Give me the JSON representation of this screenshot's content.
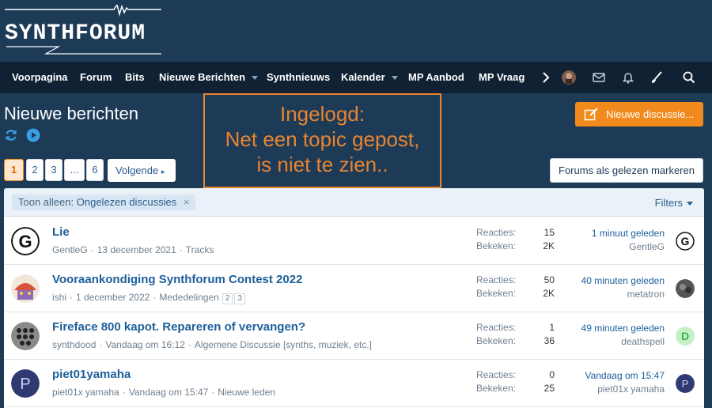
{
  "logo": {
    "text": "SYNTHFORUM"
  },
  "nav": {
    "items": [
      "Voorpagina",
      "Forum",
      "Bits",
      "Nieuwe Berichten",
      "Synthnieuws",
      "Kalender",
      "MP Aanbod",
      "MP Vraag"
    ],
    "icons": [
      "chevron-right-icon",
      "user-avatar",
      "envelope-icon",
      "bell-icon",
      "brush-icon",
      "search-icon"
    ]
  },
  "page": {
    "title": "Nieuwe berichten",
    "new_thread_label": "Nieuwe discussie...",
    "annotation": [
      "Ingelogd:",
      "Net een topic gepost,",
      "is niet te zien.."
    ],
    "mark_read_label": "Forums als gelezen markeren"
  },
  "pagination": {
    "pages": [
      "1",
      "2",
      "3",
      "...",
      "6"
    ],
    "current": "1",
    "next_label": "Volgende"
  },
  "filter": {
    "prefix": "Toon alleen:",
    "value": "Ongelezen discussies",
    "remove": "×",
    "filters_label": "Filters"
  },
  "labels": {
    "replies": "Reacties:",
    "views": "Bekeken:"
  },
  "threads": [
    {
      "title": "Lie",
      "author": "GentleG",
      "date": "13 december 2021",
      "forum": "Tracks",
      "pages": [],
      "replies": "15",
      "views": "2K",
      "last_time": "1 minuut geleden",
      "last_user": "GentleG",
      "avatar_letter": "G",
      "last_avatar_letter": "G"
    },
    {
      "title": "Vooraankondiging Synthforum Contest 2022",
      "author": "ishi",
      "date": "1 december 2022",
      "forum": "Mededelingen",
      "pages": [
        "2",
        "3"
      ],
      "replies": "50",
      "views": "2K",
      "last_time": "40 minuten geleden",
      "last_user": "metatron",
      "avatar_letter": "",
      "last_avatar_letter": ""
    },
    {
      "title": "Fireface 800 kapot. Repareren of vervangen?",
      "author": "synthdood",
      "date": "Vandaag om 16:12",
      "forum": "Algemene Discussie [synths, muziek, etc.]",
      "pages": [],
      "replies": "1",
      "views": "36",
      "last_time": "49 minuten geleden",
      "last_user": "deathspell",
      "avatar_letter": "",
      "last_avatar_letter": "D"
    },
    {
      "title": "piet01yamaha",
      "author": "piet01x yamaha",
      "date": "Vandaag om 15:47",
      "forum": "Nieuwe leden",
      "pages": [],
      "replies": "0",
      "views": "25",
      "last_time": "Vandaag om 15:47",
      "last_user": "piet01x yamaha",
      "avatar_letter": "P",
      "last_avatar_letter": "P"
    }
  ],
  "colors": {
    "header_bg": "#1d3a57",
    "nav_bg": "#0f2133",
    "accent": "#f18a1c",
    "link": "#1d5f9a"
  }
}
